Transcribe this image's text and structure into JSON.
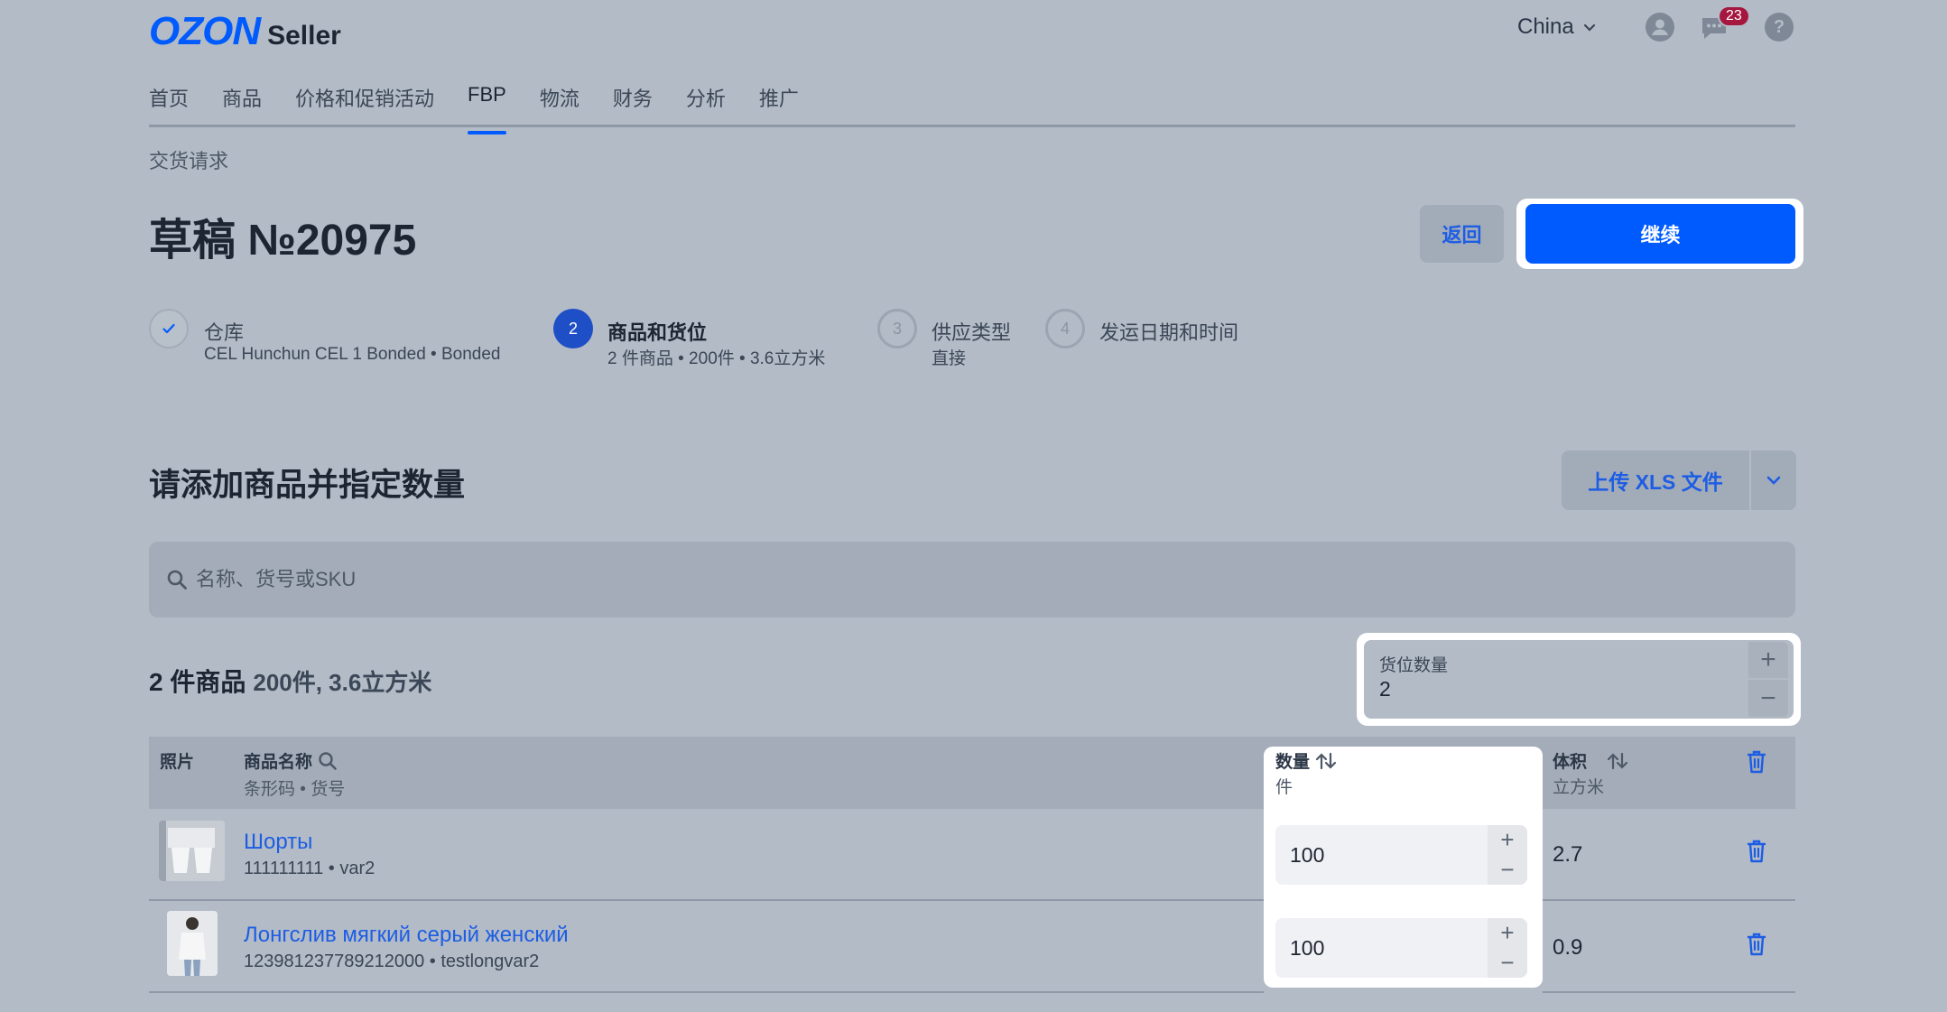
{
  "header": {
    "logo_brand": "OZON",
    "logo_product": "Seller",
    "country": "China",
    "notifications_count": "23",
    "help_label": "?"
  },
  "nav": {
    "items": [
      {
        "label": "首页",
        "active": false
      },
      {
        "label": "商品",
        "active": false
      },
      {
        "label": "价格和促销活动",
        "active": false
      },
      {
        "label": "FBP",
        "active": true
      },
      {
        "label": "物流",
        "active": false
      },
      {
        "label": "财务",
        "active": false
      },
      {
        "label": "分析",
        "active": false
      },
      {
        "label": "推广",
        "active": false
      }
    ]
  },
  "breadcrumb": "交货请求",
  "page": {
    "title": "草稿 №20975",
    "back_label": "返回",
    "continue_label": "继续"
  },
  "steps": [
    {
      "number": "",
      "title": "仓库",
      "subtitle": "CEL Hunchun CEL 1 Bonded • Bonded",
      "state": "done"
    },
    {
      "number": "2",
      "title": "商品和货位",
      "subtitle": "2 件商品 • 200件 • 3.6立方米",
      "state": "active"
    },
    {
      "number": "3",
      "title": "供应类型",
      "subtitle": "直接",
      "state": "pending"
    },
    {
      "number": "4",
      "title": "发运日期和时间",
      "subtitle": "",
      "state": "pending"
    }
  ],
  "section": {
    "title": "请添加商品并指定数量",
    "upload_label": "上传 XLS 文件"
  },
  "search": {
    "placeholder": "名称、货号或SKU"
  },
  "summary": {
    "count": "2 件商品",
    "details": "200件, 3.6立方米"
  },
  "pallets": {
    "label": "货位数量",
    "value": "2"
  },
  "table": {
    "headers": {
      "photo": "照片",
      "name": "商品名称",
      "name_sub": "条形码 • 货号",
      "qty": "数量",
      "qty_sub": "件",
      "volume": "体积",
      "volume_sub": "立方米"
    },
    "rows": [
      {
        "name": "Шорты",
        "sub": "111111111 • var2",
        "qty": "100",
        "volume": "2.7"
      },
      {
        "name": "Лонгслив мягкий серый женский",
        "sub": "123981237789212000 • testlongvar2",
        "qty": "100",
        "volume": "0.9"
      }
    ]
  },
  "colors": {
    "accent": "#005bff",
    "link": "#1d5de4",
    "background": "#b2bbc6",
    "badge": "#a5173e"
  }
}
